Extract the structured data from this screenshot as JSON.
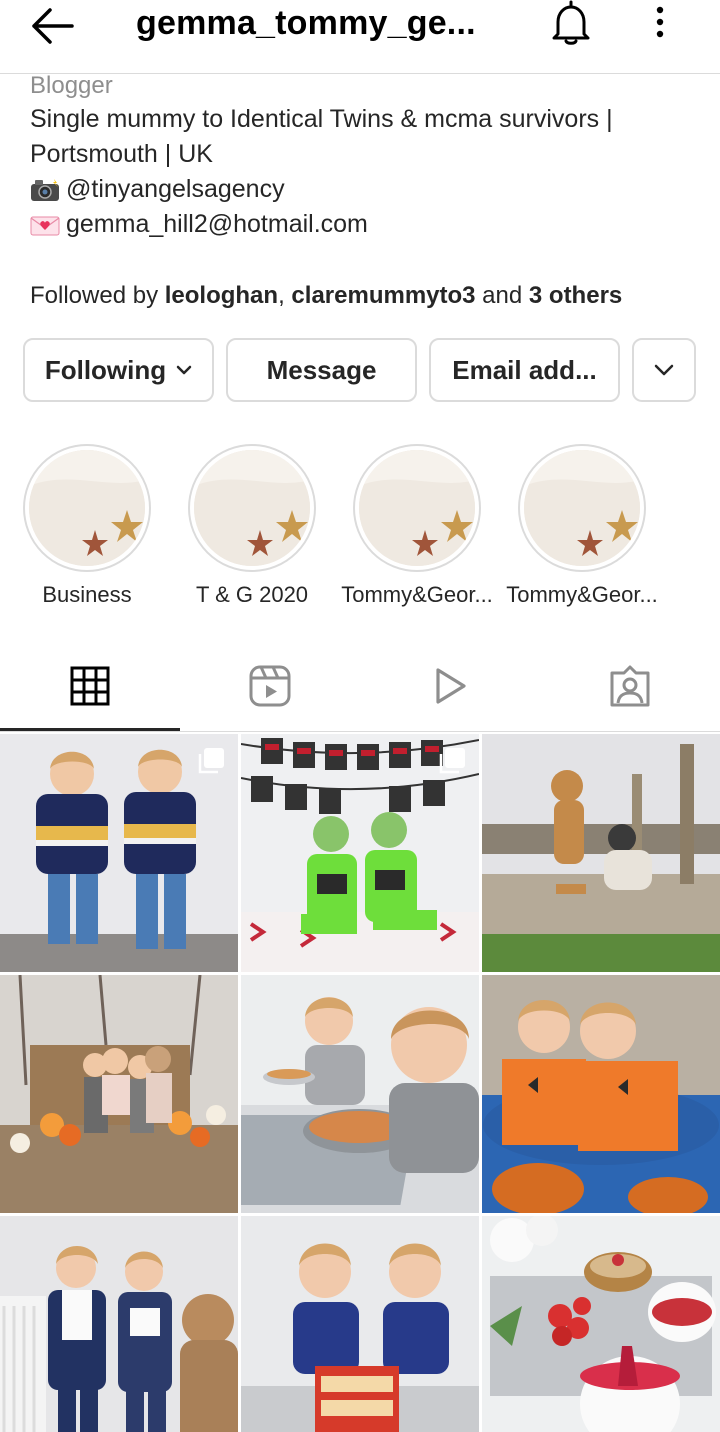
{
  "header": {
    "username": "gemma_tommy_ge...",
    "back_icon": "arrow-left-icon",
    "notification_icon": "bell-icon",
    "more_icon": "vertical-dots-icon"
  },
  "bio": {
    "category": "Blogger",
    "line1": "Single mummy to Identical Twins & mcma survivors |",
    "line2": "Portsmouth | UK",
    "agency": "@tinyangelsagency",
    "email": "gemma_hill2@hotmail.com"
  },
  "followed_by": {
    "prefix": "Followed by ",
    "user1": "leologhan",
    "comma": ", ",
    "user2": "claremummyto3",
    "and": " and ",
    "others": "3 others"
  },
  "buttons": {
    "following": "Following",
    "message": "Message",
    "email": "Email add..."
  },
  "highlights": [
    {
      "label": "Business"
    },
    {
      "label": "T & G 2020"
    },
    {
      "label": "Tommy&Geor..."
    },
    {
      "label": "Tommy&Geor..."
    }
  ],
  "tabs": [
    {
      "icon": "grid-icon",
      "active": true
    },
    {
      "icon": "reels-icon",
      "active": false
    },
    {
      "icon": "video-play-icon",
      "active": false
    },
    {
      "icon": "tagged-icon",
      "active": false
    }
  ],
  "posts": [
    {
      "desc": "twins in puffer jackets",
      "multi": true
    },
    {
      "desc": "happy halloween twins",
      "multi": true
    },
    {
      "desc": "two dogs on bench",
      "multi": false
    },
    {
      "desc": "pumpkin patch family",
      "multi": false
    },
    {
      "desc": "twins eating spaghetti",
      "multi": false
    },
    {
      "desc": "twins in pumpkin costumes",
      "multi": false
    },
    {
      "desc": "twins with dog",
      "multi": false
    },
    {
      "desc": "twins with toy bus",
      "multi": false
    },
    {
      "desc": "yogurt and strawberries",
      "multi": false
    }
  ],
  "colors": {
    "border": "#dbdbdb",
    "text": "#262626",
    "muted": "#8e8e8e"
  }
}
